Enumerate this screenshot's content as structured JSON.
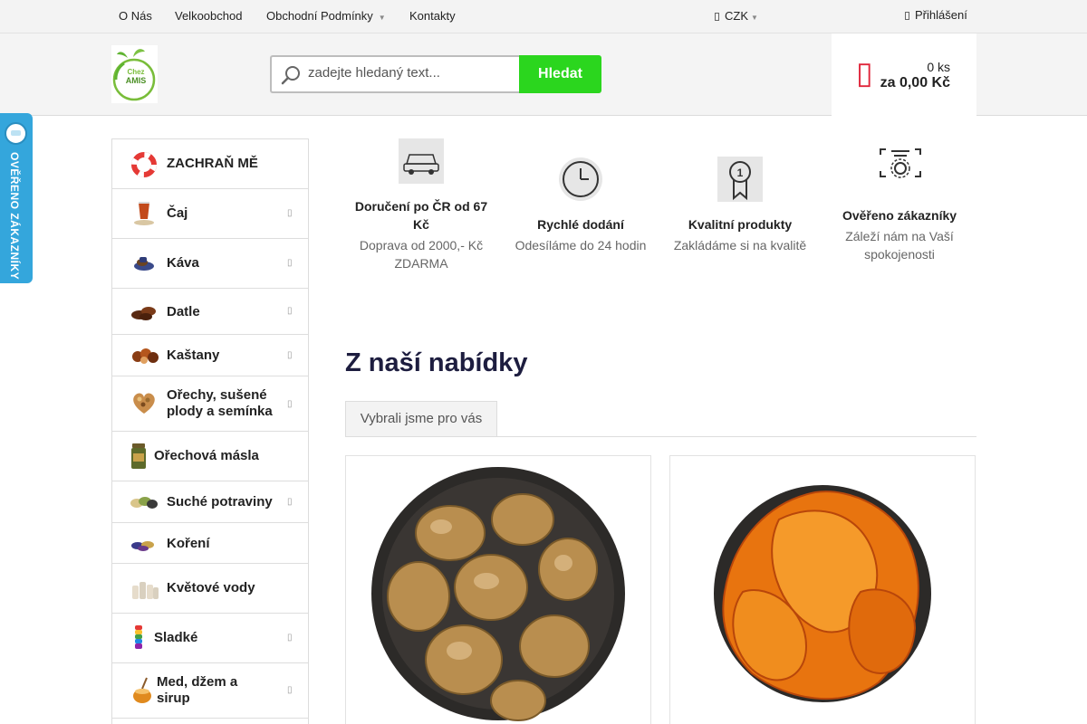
{
  "topnav": {
    "links": [
      "O Nás",
      "Velkoobchod",
      "Obchodní Podmínky",
      "Kontakty"
    ],
    "currency": "CZK",
    "login": "Přihlášení"
  },
  "logo": {
    "line1": "Chez",
    "line2": "AMIS"
  },
  "search": {
    "placeholder": "zadejte hledaný text...",
    "button": "Hledat"
  },
  "cart": {
    "count": "0 ks",
    "total": "za 0,00 Kč"
  },
  "verified_badge": "OVĚŘENO ZÁKAZNÍKY",
  "categories": [
    {
      "label": "ZACHRAŇ MĚ",
      "icon": "lifebuoy-icon"
    },
    {
      "label": "Čaj",
      "icon": "tea-glass-icon"
    },
    {
      "label": "Káva",
      "icon": "coffee-icon"
    },
    {
      "label": "Datle",
      "icon": "dates-icon"
    },
    {
      "label": "Kaštany",
      "icon": "chestnuts-icon"
    },
    {
      "label": "Ořechy, sušené plody a semínka",
      "icon": "nuts-heart-icon"
    },
    {
      "label": "Ořechová másla",
      "icon": "nut-butter-jar-icon"
    },
    {
      "label": "Suché potraviny",
      "icon": "dry-food-icon"
    },
    {
      "label": "Koření",
      "icon": "spices-icon"
    },
    {
      "label": "Květové vody",
      "icon": "flower-water-bottles-icon"
    },
    {
      "label": "Sladké",
      "icon": "sweets-icon"
    },
    {
      "label": "Med, džem a sirup",
      "icon": "honey-icon"
    }
  ],
  "features": [
    {
      "title": "Doručení po ČR od 67 Kč",
      "desc": "Doprava od 2000,- Kč ZDARMA",
      "icon": "car-icon"
    },
    {
      "title": "Rychlé dodání",
      "desc": "Odesíláme do 24 hodin",
      "icon": "clock-icon"
    },
    {
      "title": "Kvalitní produkty",
      "desc": "Zakládáme si na kvalitě",
      "icon": "award-ribbon-icon"
    },
    {
      "title": "Ověřeno zákazníky",
      "desc": "Záleží nám na Vaší spokojenosti",
      "icon": "verified-seal-icon"
    }
  ],
  "section": {
    "title": "Z naší nabídky",
    "tab": "Vybrali jsme pro vás"
  },
  "products": [
    {
      "image": "dried-figs-bowl-image"
    },
    {
      "image": "dried-mango-bowl-image"
    }
  ],
  "colors": {
    "accent_green": "#2bd61e",
    "cart_red": "#e0263b",
    "badge_blue": "#34a6dc",
    "heading_navy": "#1d1d3f"
  }
}
